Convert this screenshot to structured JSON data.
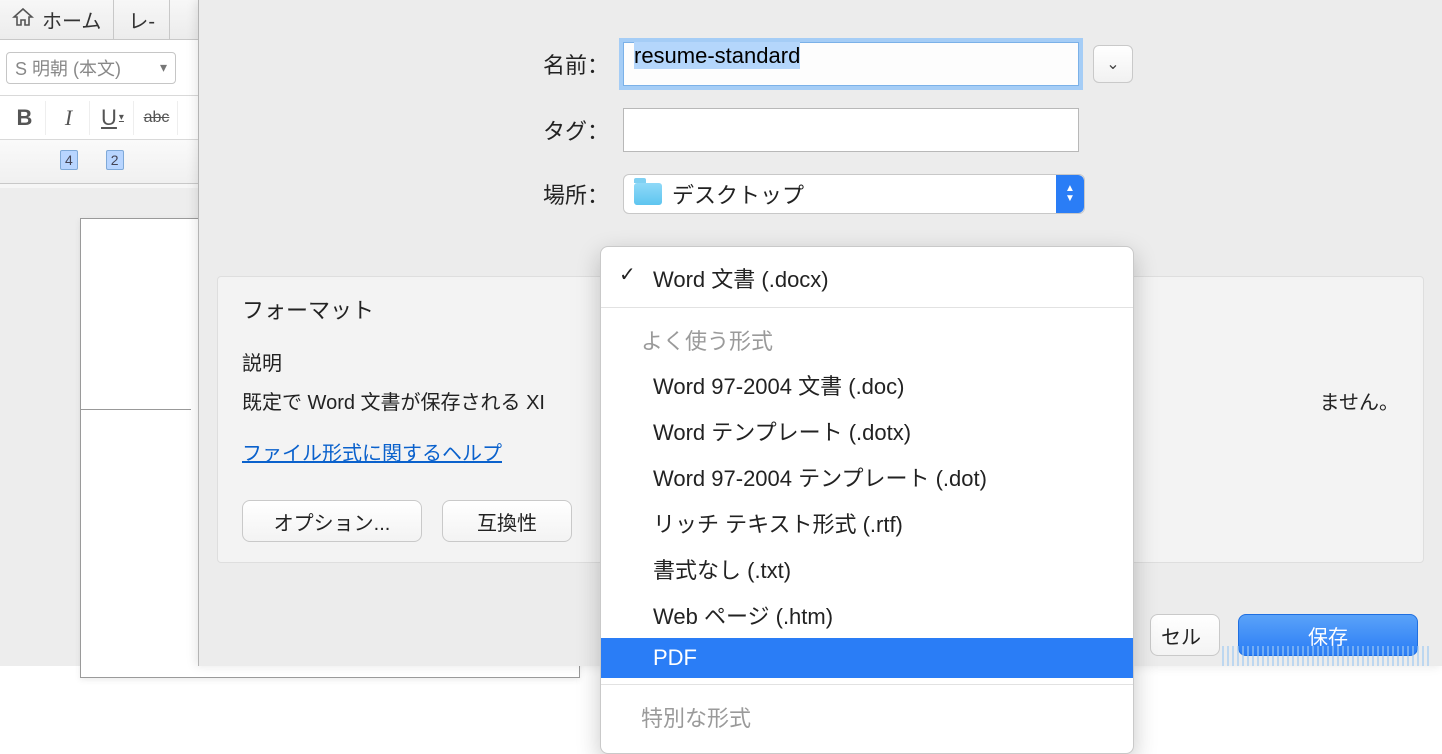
{
  "bg": {
    "tab_home": "ホーム",
    "tab_next_partial": "レ-",
    "font_combo": "S 明朝 (本文)",
    "style_bold": "B",
    "style_italic": "I",
    "style_underline": "U",
    "style_strike": "abc",
    "ruler_4": "4",
    "ruler_2": "2"
  },
  "dialog": {
    "name_label": "名前：",
    "name_value": "resume-standard",
    "tags_label": "タグ：",
    "location_label": "場所：",
    "location_value": "デスクトップ",
    "format_label": "フォーマット",
    "desc_head": "説明",
    "desc_text_visible": "既定で Word 文書が保存される XI",
    "desc_text_tail": "ません。",
    "help_link": "ファイル形式に関するヘルプ",
    "options_btn": "オプション...",
    "compat_btn_partial": "互換性",
    "cancel_btn_partial": "セル",
    "save_btn": "保存"
  },
  "dropdown": {
    "selected": "Word 文書 (.docx)",
    "section1": "よく使う形式",
    "items1": [
      "Word 97-2004 文書 (.doc)",
      "Word テンプレート (.dotx)",
      "Word 97-2004 テンプレート (.dot)",
      "リッチ テキスト形式 (.rtf)",
      "書式なし (.txt)",
      "Web ページ (.htm)",
      "PDF"
    ],
    "section2": "特別な形式"
  }
}
